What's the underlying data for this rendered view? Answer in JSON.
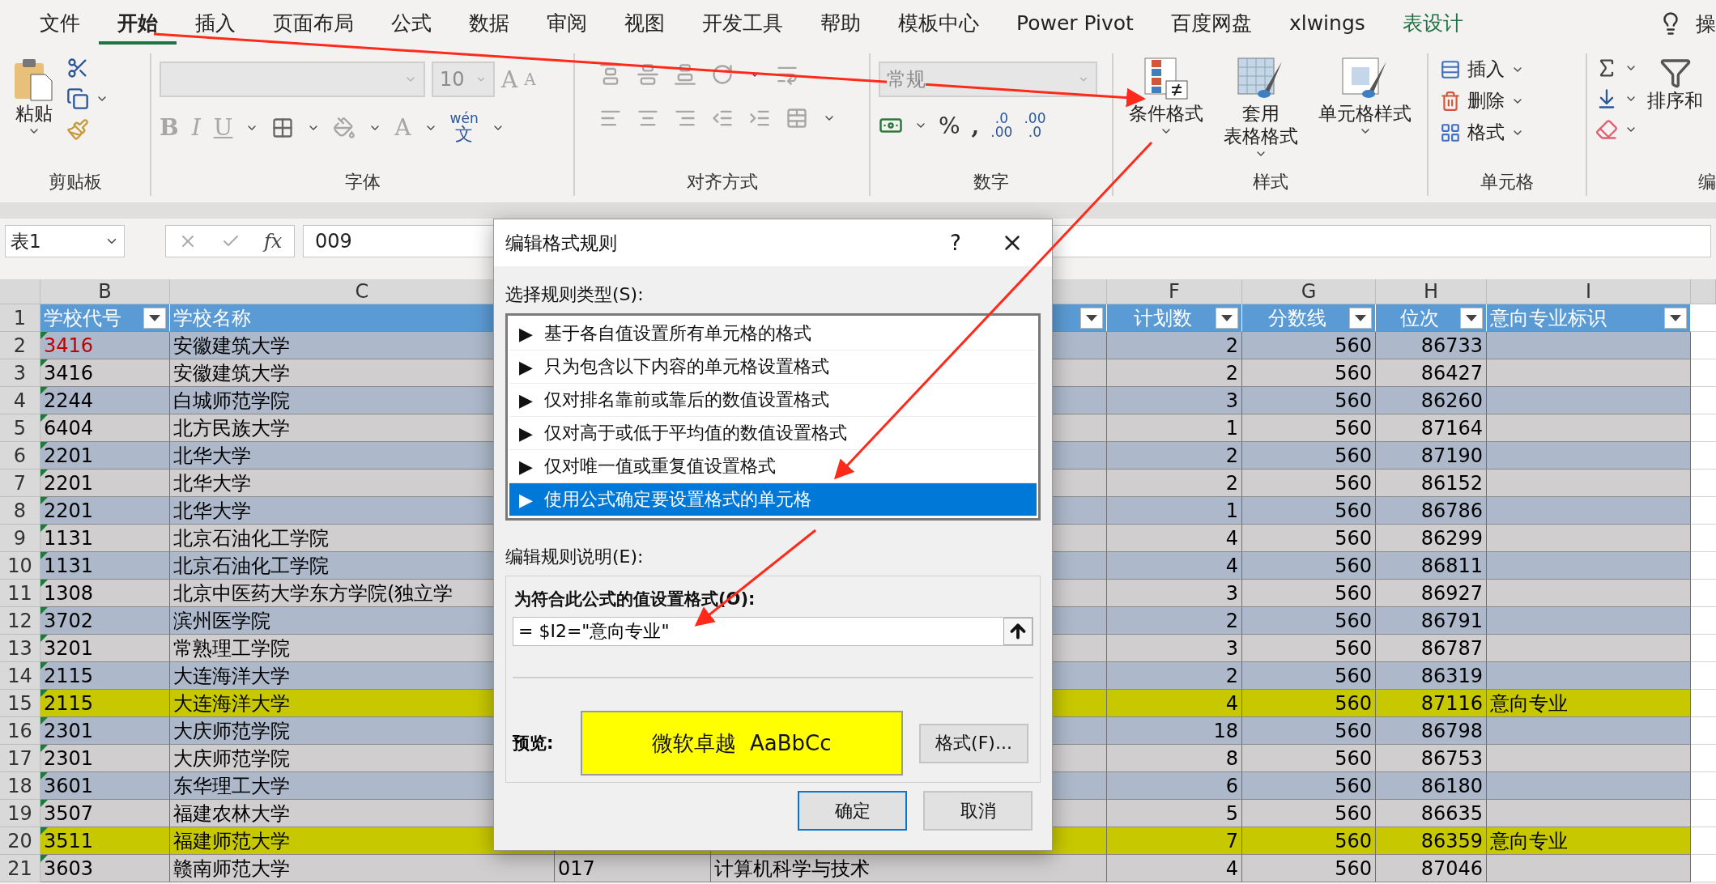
{
  "menu_tabs": [
    {
      "label": "文件",
      "selected": false,
      "kind": "normal"
    },
    {
      "label": "开始",
      "selected": true,
      "kind": "normal"
    },
    {
      "label": "插入",
      "selected": false,
      "kind": "normal"
    },
    {
      "label": "页面布局",
      "selected": false,
      "kind": "normal"
    },
    {
      "label": "公式",
      "selected": false,
      "kind": "normal"
    },
    {
      "label": "数据",
      "selected": false,
      "kind": "normal"
    },
    {
      "label": "审阅",
      "selected": false,
      "kind": "normal"
    },
    {
      "label": "视图",
      "selected": false,
      "kind": "normal"
    },
    {
      "label": "开发工具",
      "selected": false,
      "kind": "normal"
    },
    {
      "label": "帮助",
      "selected": false,
      "kind": "normal"
    },
    {
      "label": "模板中心",
      "selected": false,
      "kind": "normal"
    },
    {
      "label": "Power Pivot",
      "selected": false,
      "kind": "normal"
    },
    {
      "label": "百度网盘",
      "selected": false,
      "kind": "normal"
    },
    {
      "label": "xlwings",
      "selected": false,
      "kind": "normal"
    },
    {
      "label": "表设计",
      "selected": false,
      "kind": "contextual"
    }
  ],
  "tell_me": "操",
  "ribbon": {
    "clipboard": {
      "paste": "粘贴",
      "label": "剪贴板"
    },
    "font": {
      "size": "10",
      "grow": "A",
      "shrink": "A",
      "bold": "B",
      "italic": "I",
      "underline": "U",
      "font_color": "A",
      "phonetic_top": "wén",
      "phonetic_bottom": "文",
      "label": "字体"
    },
    "alignment": {
      "label": "对齐方式"
    },
    "number": {
      "format": "常规",
      "percent": "%",
      "comma": ",",
      "increase_decimal": [
        ".0",
        ".00"
      ],
      "decrease_decimal": [
        ".00",
        ".0"
      ],
      "label": "数字"
    },
    "styles": {
      "buttons": [
        {
          "lines": [
            "条件格式"
          ],
          "kind": "conditional"
        },
        {
          "lines": [
            "套用",
            "表格格式"
          ],
          "kind": "table"
        },
        {
          "lines": [
            "单元格样式"
          ],
          "kind": "cell"
        }
      ],
      "label": "样式"
    },
    "cells": {
      "buttons": [
        {
          "label": "插入",
          "kind": "insert"
        },
        {
          "label": "删除",
          "kind": "delete"
        },
        {
          "label": "格式",
          "kind": "format"
        }
      ],
      "label": "单元格"
    },
    "editing": {
      "sort": "排序和",
      "label": "编"
    }
  },
  "formula_bar": {
    "name_box": "表1",
    "fx": "fx",
    "formula": "009"
  },
  "columns": [
    {
      "letter": "B",
      "header": "学校代号",
      "filter": true
    },
    {
      "letter": "C",
      "header": "学校名称",
      "filter": false
    },
    {
      "filter": true
    },
    {
      "letter": "F",
      "header": "计划数",
      "filter": true
    },
    {
      "letter": "G",
      "header": "分数线",
      "filter": true
    },
    {
      "letter": "H",
      "header": "位次",
      "filter": true
    },
    {
      "letter": "I",
      "header": "意向专业标识",
      "filter": true
    }
  ],
  "header_row_num": "1",
  "rows": [
    {
      "num": "2",
      "b": "3416",
      "c": "安徽建筑大学",
      "f": "2",
      "g": "560",
      "h": "86733",
      "highlighted": false,
      "code_red": true
    },
    {
      "num": "3",
      "b": "3416",
      "c": "安徽建筑大学",
      "f": "2",
      "g": "560",
      "h": "86427",
      "highlighted": false,
      "code_red": false
    },
    {
      "num": "4",
      "b": "2244",
      "c": "白城师范学院",
      "f": "3",
      "g": "560",
      "h": "86260",
      "highlighted": false,
      "code_red": false
    },
    {
      "num": "5",
      "b": "6404",
      "c": "北方民族大学",
      "f": "1",
      "g": "560",
      "h": "87164",
      "highlighted": false,
      "code_red": false
    },
    {
      "num": "6",
      "b": "2201",
      "c": "北华大学",
      "f": "2",
      "g": "560",
      "h": "87190",
      "highlighted": false,
      "code_red": false
    },
    {
      "num": "7",
      "b": "2201",
      "c": "北华大学",
      "f": "2",
      "g": "560",
      "h": "86152",
      "highlighted": false,
      "code_red": false
    },
    {
      "num": "8",
      "b": "2201",
      "c": "北华大学",
      "f": "1",
      "g": "560",
      "h": "86786",
      "highlighted": false,
      "code_red": false
    },
    {
      "num": "9",
      "b": "1131",
      "c": "北京石油化工学院",
      "f": "4",
      "g": "560",
      "h": "86299",
      "highlighted": false,
      "code_red": false
    },
    {
      "num": "10",
      "b": "1131",
      "c": "北京石油化工学院",
      "f": "4",
      "g": "560",
      "h": "86811",
      "highlighted": false,
      "code_red": false
    },
    {
      "num": "11",
      "b": "1308",
      "c": "北京中医药大学东方学院(独立学",
      "f": "3",
      "g": "560",
      "h": "86927",
      "highlighted": false,
      "code_red": false
    },
    {
      "num": "12",
      "b": "3702",
      "c": "滨州医学院",
      "f": "2",
      "g": "560",
      "h": "86791",
      "highlighted": false,
      "code_red": false
    },
    {
      "num": "13",
      "b": "3201",
      "c": "常熟理工学院",
      "f": "3",
      "g": "560",
      "h": "86787",
      "highlighted": false,
      "code_red": false
    },
    {
      "num": "14",
      "b": "2115",
      "c": "大连海洋大学",
      "f": "2",
      "g": "560",
      "h": "86319",
      "highlighted": false,
      "code_red": false
    },
    {
      "num": "15",
      "b": "2115",
      "c": "大连海洋大学",
      "f": "4",
      "g": "560",
      "h": "87116",
      "i": "意向专业",
      "highlighted": true,
      "code_red": false
    },
    {
      "num": "16",
      "b": "2301",
      "c": "大庆师范学院",
      "f": "18",
      "g": "560",
      "h": "86798",
      "highlighted": false,
      "code_red": false
    },
    {
      "num": "17",
      "b": "2301",
      "c": "大庆师范学院",
      "f": "8",
      "g": "560",
      "h": "86753",
      "highlighted": false,
      "code_red": false
    },
    {
      "num": "18",
      "b": "3601",
      "c": "东华理工大学",
      "f": "6",
      "g": "560",
      "h": "86180",
      "highlighted": false,
      "code_red": false
    },
    {
      "num": "19",
      "b": "3507",
      "c": "福建农林大学",
      "f": "5",
      "g": "560",
      "h": "86635",
      "highlighted": false,
      "code_red": false
    },
    {
      "num": "20",
      "b": "3511",
      "c": "福建师范大学",
      "f": "7",
      "g": "560",
      "h": "86359",
      "i": "意向专业",
      "highlighted": true,
      "code_red": false
    },
    {
      "num": "21",
      "b": "3603",
      "c": "赣南师范大学",
      "d": "017",
      "e": "计算机科学与技术",
      "f": "4",
      "g": "560",
      "h": "87046",
      "highlighted": false,
      "code_red": false
    }
  ],
  "dialog": {
    "title": "编辑格式规则",
    "help": "?",
    "select_label": "选择规则类型(S):",
    "rule_types": [
      {
        "bullet": "▶",
        "label": "基于各自值设置所有单元格的格式",
        "selected": false
      },
      {
        "bullet": "▶",
        "label": "只为包含以下内容的单元格设置格式",
        "selected": false
      },
      {
        "bullet": "▶",
        "label": "仅对排名靠前或靠后的数值设置格式",
        "selected": false
      },
      {
        "bullet": "▶",
        "label": "仅对高于或低于平均值的数值设置格式",
        "selected": false
      },
      {
        "bullet": "▶",
        "label": "仅对唯一值或重复值设置格式",
        "selected": false
      },
      {
        "bullet": "▶",
        "label": "使用公式确定要设置格式的单元格",
        "selected": true
      }
    ],
    "edit_label": "编辑规则说明(E):",
    "formula_label": "为符合此公式的值设置格式(O):",
    "formula": "= $I2=\"意向专业\"",
    "preview_label": "预览:",
    "preview_text": "微软卓越  AaBbCc",
    "format_button": "格式(F)...",
    "ok": "确定",
    "cancel": "取消"
  }
}
